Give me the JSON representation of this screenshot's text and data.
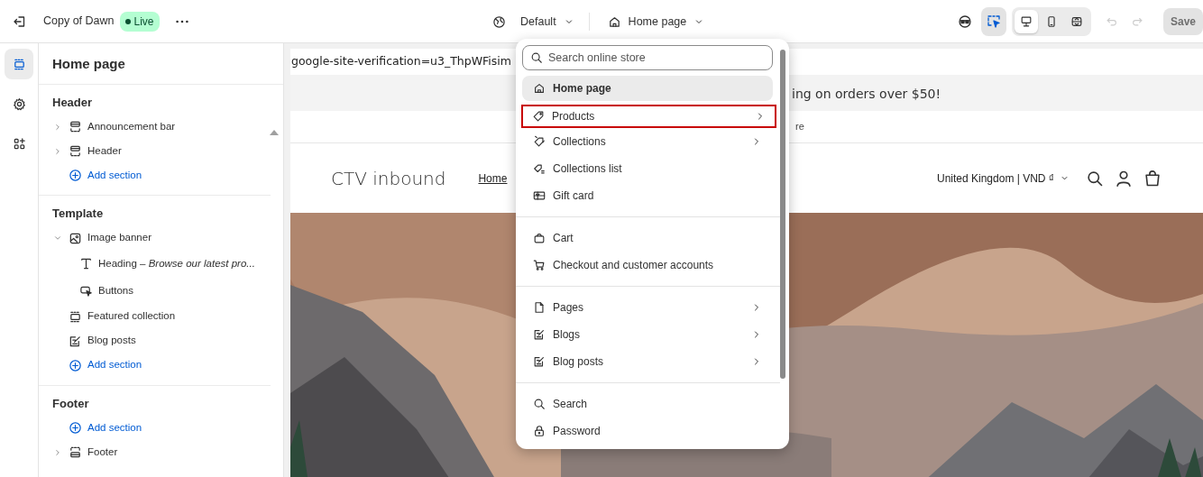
{
  "topbar": {
    "theme_name": "Copy of Dawn",
    "status": "Live",
    "theme_picker": "Default",
    "page_picker": "Home page",
    "inspector_on": true,
    "save": {
      "label": "Save",
      "disabled": true
    },
    "devices": [
      {
        "selected": true
      },
      {
        "selected": false
      },
      {
        "selected": false
      }
    ]
  },
  "rail": [
    {
      "selected": true
    },
    {
      "selected": false
    },
    {
      "selected": false
    }
  ],
  "sidebar": {
    "title": "Home page",
    "groups": [
      {
        "heading": "Header",
        "items": [
          {
            "kind": "section",
            "label": "Announcement bar",
            "expanded": false
          },
          {
            "kind": "section",
            "label": "Header",
            "expanded": false
          },
          {
            "kind": "add",
            "label": "Add section"
          }
        ]
      },
      {
        "heading": "Template",
        "items": [
          {
            "kind": "section",
            "label": "Image banner",
            "expanded": true,
            "children": [
              {
                "kind": "block",
                "label": "Heading – *Browse our latest pro...*"
              },
              {
                "kind": "block",
                "label": "Buttons"
              }
            ]
          },
          {
            "kind": "section",
            "label": "Featured collection"
          },
          {
            "kind": "section",
            "label": "Blog posts"
          },
          {
            "kind": "add",
            "label": "Add section"
          }
        ]
      },
      {
        "heading": "Footer",
        "items": [
          {
            "kind": "add",
            "label": "Add section"
          },
          {
            "kind": "section",
            "label": "Footer",
            "expanded": false
          }
        ]
      }
    ]
  },
  "preview": {
    "verification": "google-site-verification=u3_ThpWFisim",
    "announcement": "ing on orders over $50!",
    "line_2": "re",
    "store_name": "CTV inbound",
    "nav": [
      "Home"
    ],
    "locale": "United Kingdom | VND ₫",
    "banner": {
      "kind": "picture"
    }
  },
  "dropdown": {
    "placeholder": "Search online store",
    "groups": [
      [
        {
          "label": "Home page",
          "selected": true,
          "submenu": false,
          "focused": false
        },
        {
          "label": "Products",
          "selected": false,
          "submenu": true,
          "focused": true
        },
        {
          "label": "Collections",
          "selected": false,
          "submenu": true,
          "focused": false
        },
        {
          "label": "Collections list",
          "selected": false,
          "submenu": false,
          "focused": false
        },
        {
          "label": "Gift card",
          "selected": false,
          "submenu": false,
          "focused": false
        }
      ],
      [
        {
          "label": "Cart",
          "selected": false,
          "submenu": false,
          "focused": false
        },
        {
          "label": "Checkout and customer accounts",
          "selected": false,
          "submenu": false,
          "focused": false
        }
      ],
      [
        {
          "label": "Pages",
          "selected": false,
          "submenu": true,
          "focused": false
        },
        {
          "label": "Blogs",
          "selected": false,
          "submenu": true,
          "focused": false
        },
        {
          "label": "Blog posts",
          "selected": false,
          "submenu": true,
          "focused": false
        }
      ],
      [
        {
          "label": "Search",
          "selected": false,
          "submenu": false,
          "focused": false
        },
        {
          "label": "Password",
          "selected": false,
          "submenu": false,
          "focused": false
        }
      ]
    ]
  }
}
